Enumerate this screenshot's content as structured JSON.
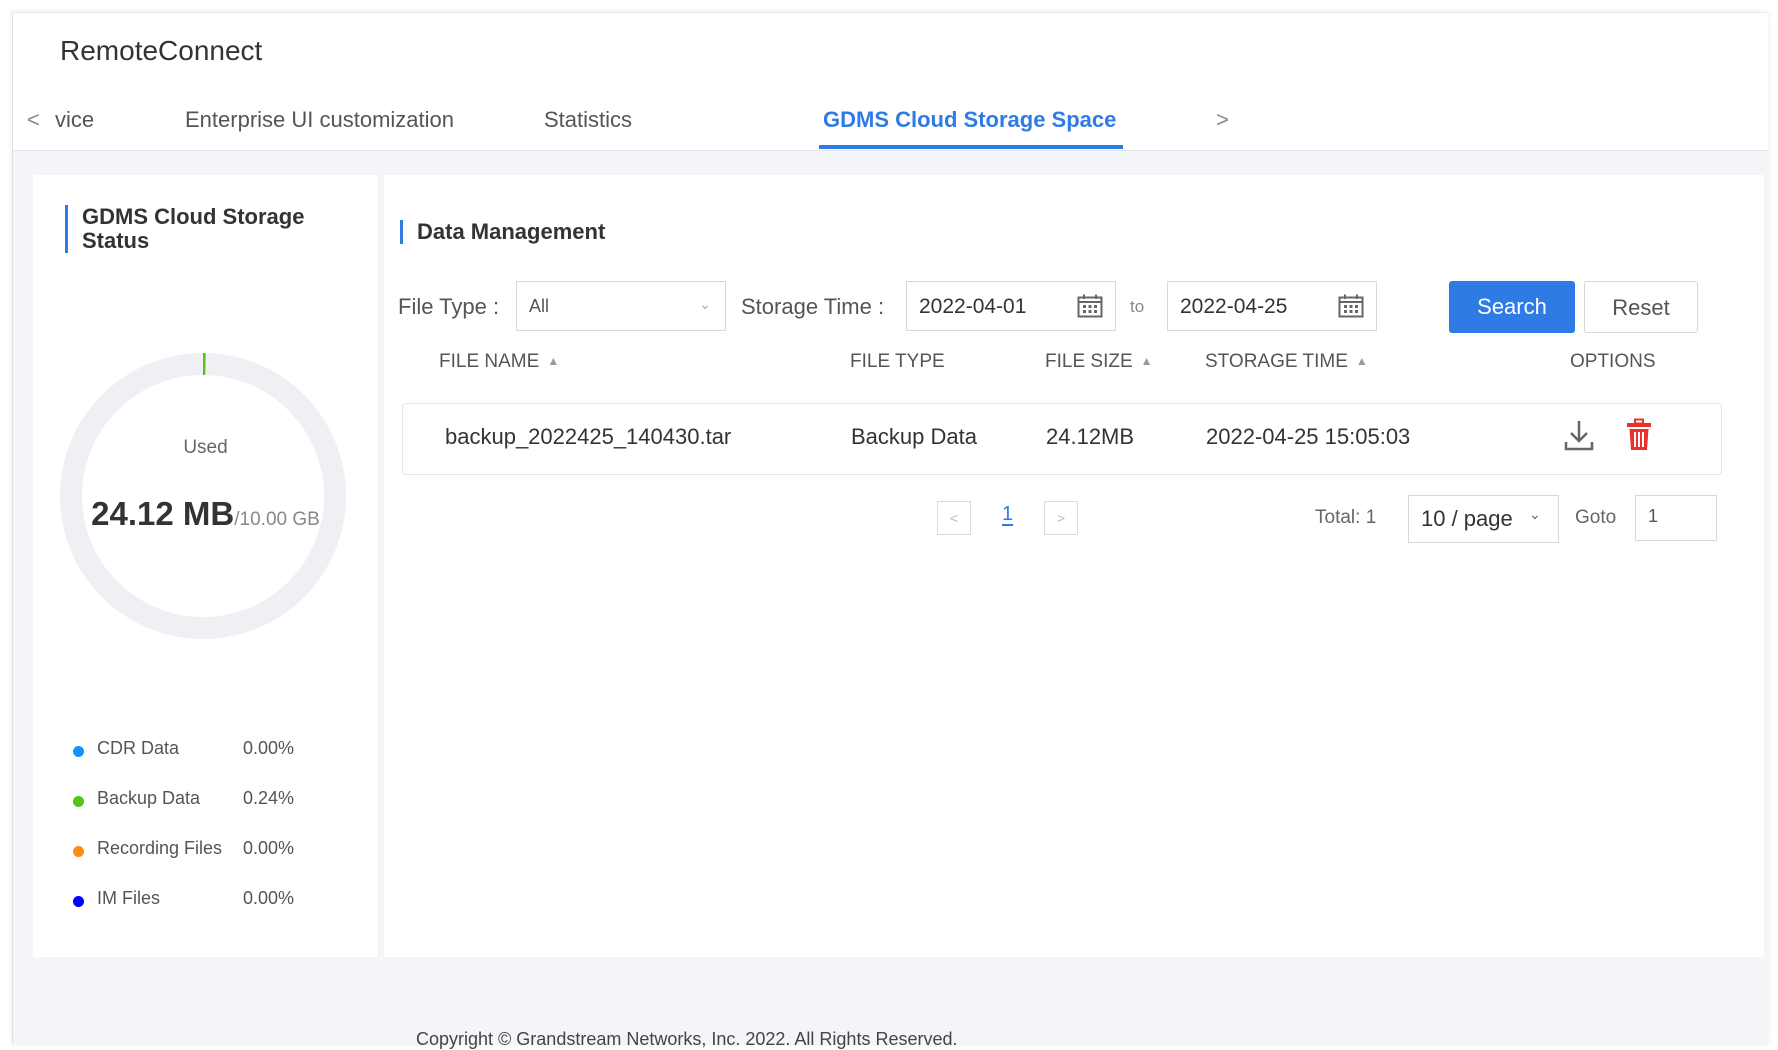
{
  "app": {
    "title": "RemoteConnect"
  },
  "tabs": {
    "prev_icon": "chevron-left-icon",
    "next_icon": "chevron-right-icon",
    "items": [
      {
        "label": "vice",
        "active": false
      },
      {
        "label": "Enterprise UI customization",
        "active": false
      },
      {
        "label": "Statistics",
        "active": false
      },
      {
        "label": "GDMS Cloud Storage Space",
        "active": true
      }
    ]
  },
  "status_panel": {
    "title_line1": "GDMS Cloud Storage",
    "title_line2": "Status",
    "used_label": "Used",
    "used_value": "24.12 MB",
    "total_value": "/10.00 GB",
    "used_fraction": 0.0024,
    "ring_track_color": "#eef0f4",
    "ring_fill_color": "#52c41a",
    "legend": [
      {
        "label": "CDR Data",
        "value": "0.00%",
        "color": "#1890ff"
      },
      {
        "label": "Backup Data",
        "value": "0.24%",
        "color": "#52c41a"
      },
      {
        "label": "Recording Files",
        "value": "0.00%",
        "color": "#fa8c16"
      },
      {
        "label": "IM Files",
        "value": "0.00%",
        "color": "#0000ff"
      }
    ]
  },
  "data_management": {
    "title": "Data Management",
    "filters": {
      "file_type_label": "File Type",
      "file_type_value": "All",
      "storage_time_label": "Storage Time",
      "start_date": "2022-04-01",
      "to_label": "to",
      "end_date": "2022-04-25",
      "search_label": "Search",
      "reset_label": "Reset"
    },
    "columns": {
      "file_name": "FILE NAME",
      "file_type": "FILE TYPE",
      "file_size": "FILE SIZE",
      "storage_time": "STORAGE TIME",
      "options": "OPTIONS"
    },
    "rows": [
      {
        "file_name": "backup_2022425_140430.tar",
        "file_type": "Backup Data",
        "file_size": "24.12MB",
        "storage_time": "2022-04-25 15:05:03"
      }
    ],
    "pagination": {
      "current_page": "1",
      "total_label": "Total: 1",
      "per_page": "10 / page",
      "goto_label": "Goto",
      "goto_value": "1"
    }
  },
  "footer": {
    "text": "Copyright © Grandstream Networks, Inc. 2022. All Rights Reserved."
  }
}
